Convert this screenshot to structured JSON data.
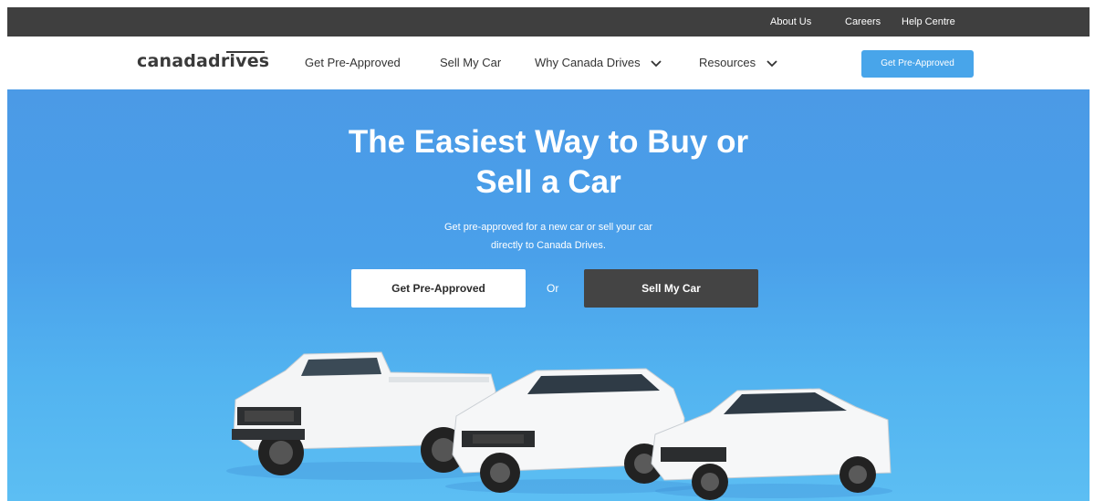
{
  "util_bar": {
    "links": [
      "About Us",
      "Careers",
      "Help Centre"
    ]
  },
  "nav": {
    "logo": "canadadrives",
    "items": [
      "Get Pre-Approved",
      "Sell My Car",
      "Why Canada Drives",
      "Resources"
    ],
    "cta": "Get Pre-Approved"
  },
  "hero": {
    "title_line1": "The Easiest Way to Buy or",
    "title_line2": "Sell a Car",
    "subtitle_line1": "Get pre-approved for a new car or sell your car",
    "subtitle_line2": "directly to Canada Drives.",
    "primary_button": "Get Pre-Approved",
    "or_text": "Or",
    "secondary_button": "Sell My Car"
  },
  "colors": {
    "util_bar": "#3f3f3f",
    "hero_bg": "#4b9ae6",
    "nav_cta": "#48a5ea",
    "dark_button": "#444444"
  },
  "icons": [
    "chevron-down-icon",
    "chevron-down-icon"
  ]
}
